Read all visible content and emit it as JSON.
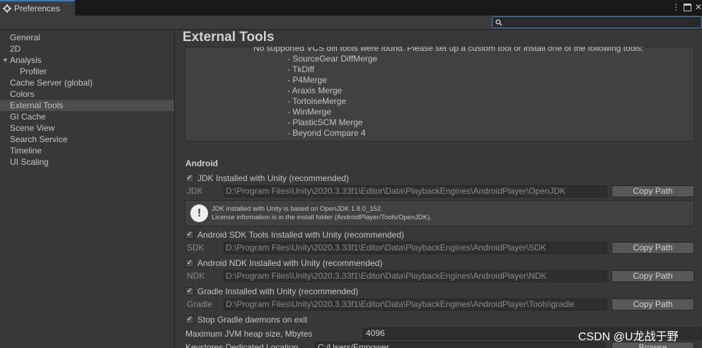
{
  "window": {
    "tab_label": "Preferences",
    "menu_icon": "kebab-menu-icon",
    "maximize_icon": "maximize-icon",
    "close_icon": "close-icon"
  },
  "search": {
    "placeholder": "",
    "icon": "search-icon"
  },
  "sidebar": {
    "items": [
      {
        "label": "General"
      },
      {
        "label": "2D"
      },
      {
        "label": "Analysis"
      },
      {
        "label": "Profiler"
      },
      {
        "label": "Cache Server (global)"
      },
      {
        "label": "Colors"
      },
      {
        "label": "External Tools"
      },
      {
        "label": "GI Cache"
      },
      {
        "label": "Scene View"
      },
      {
        "label": "Search Service"
      },
      {
        "label": "Timeline"
      },
      {
        "label": "UI Scaling"
      }
    ],
    "selected": "External Tools"
  },
  "main": {
    "title": "External Tools",
    "vcs": {
      "message": "No supported VCS diff tools were found. Please set up a custom tool or install one of the following tools:",
      "tools": [
        "- SourceGear DiffMerge",
        "- TkDiff",
        "- P4Merge",
        "- Araxis Merge",
        "- TortoiseMerge",
        "- WinMerge",
        "- PlasticSCM Merge",
        "- Beyond Compare 4"
      ]
    },
    "android": {
      "section_label": "Android",
      "jdk_checkbox": "JDK Installed with Unity (recommended)",
      "jdk_label": "JDK",
      "jdk_path": "D:\\Program Files\\Unity\\2020.3.33f1\\Editor\\Data\\PlaybackEngines\\AndroidPlayer\\OpenJDK",
      "copy_path": "Copy Path",
      "info_line1": "JDK installed with Unity is based on OpenJDK 1.8.0_152.",
      "info_line2": "License information is in the install folder (AndroidPlayer/Tools/OpenJDK).",
      "sdk_checkbox": "Android SDK Tools Installed with Unity (recommended)",
      "sdk_label": "SDK",
      "sdk_path": "D:\\Program Files\\Unity\\2020.3.33f1\\Editor\\Data\\PlaybackEngines\\AndroidPlayer\\SDK",
      "ndk_checkbox": "Android NDK Installed with Unity (recommended)",
      "ndk_label": "NDK",
      "ndk_path": "D:\\Program Files\\Unity\\2020.3.33f1\\Editor\\Data\\PlaybackEngines\\AndroidPlayer\\NDK",
      "gradle_checkbox": "Gradle Installed with Unity (recommended)",
      "gradle_label": "Gradle",
      "gradle_path": "D:\\Program Files\\Unity\\2020.3.33f1\\Editor\\Data\\PlaybackEngines\\AndroidPlayer\\Tools\\gradle",
      "stop_gradle_checkbox": "Stop Gradle daemons on exit",
      "jvm_label": "Maximum JVM heap size, Mbytes",
      "jvm_value": "4096",
      "keystores_label": "Keystores Dedicated Location",
      "keystores_value": "C:/Users/Empower",
      "browse": "Browse"
    }
  },
  "watermark": "CSDN @U龙战于野",
  "colors": {
    "accent": "#3a79bb",
    "selection": "#4d4d4d",
    "background": "#383838"
  }
}
